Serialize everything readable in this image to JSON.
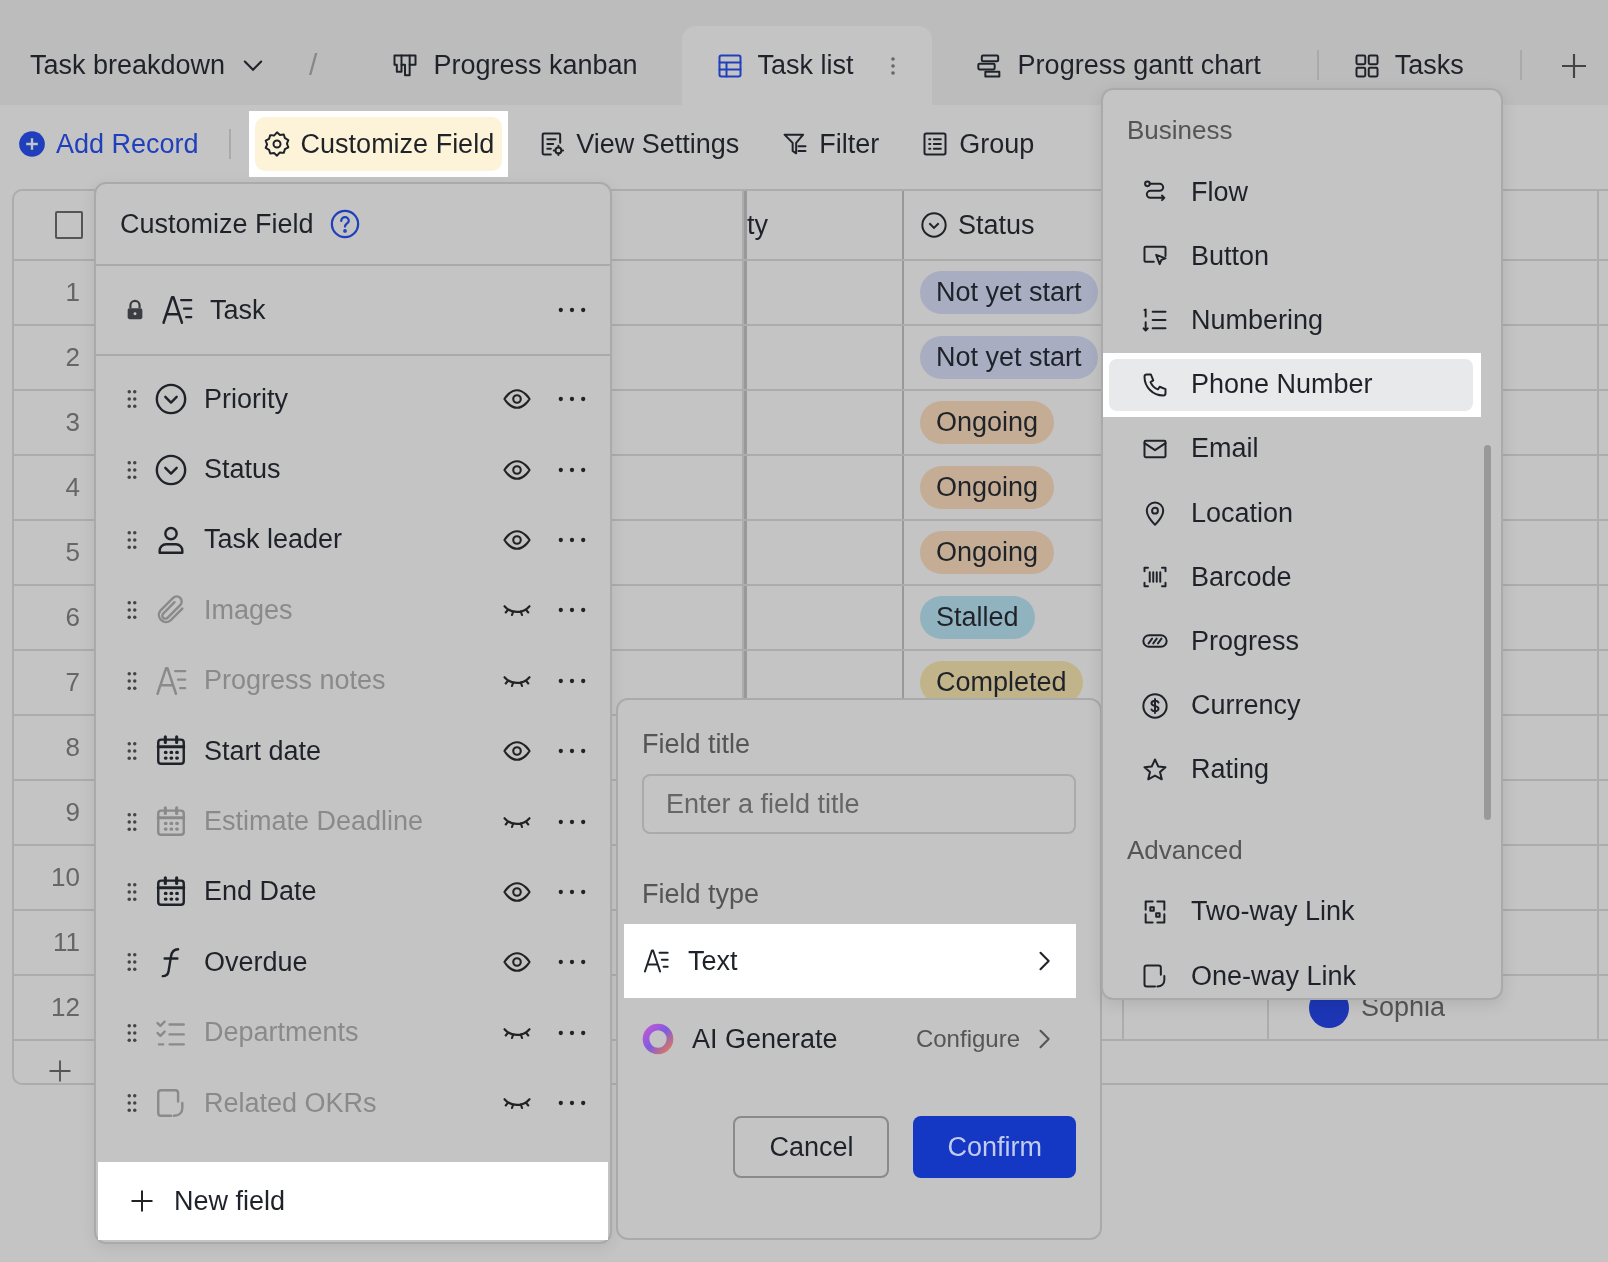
{
  "topbar": {
    "table_name": "Task breakdown",
    "separator": "/",
    "views": [
      {
        "label": "Progress kanban",
        "kind": "kanban",
        "selected": false
      },
      {
        "label": "Task list",
        "kind": "grid",
        "selected": true
      },
      {
        "label": "Progress gantt chart",
        "kind": "gantt",
        "selected": false
      },
      {
        "label": "Tasks",
        "kind": "gallery",
        "selected": false
      }
    ]
  },
  "toolbar": {
    "add_record": "Add Record",
    "items": [
      {
        "label": "Customize Field",
        "kind": "gear",
        "highlighted": true
      },
      {
        "label": "View Settings",
        "kind": "settings",
        "highlighted": false
      },
      {
        "label": "Filter",
        "kind": "filter",
        "highlighted": false
      },
      {
        "label": "Group",
        "kind": "group",
        "highlighted": false
      }
    ]
  },
  "table": {
    "select_all": {
      "checked": false
    },
    "columns": [
      "ty",
      "Status"
    ],
    "rows": [
      {
        "number": "1",
        "status": "Not yet start",
        "color": "#a8adc2"
      },
      {
        "number": "2",
        "status": "Not yet start",
        "color": "#a8adc2"
      },
      {
        "number": "3",
        "status": "Ongoing",
        "color": "#c4ad94"
      },
      {
        "number": "4",
        "status": "Ongoing",
        "color": "#c4ad94"
      },
      {
        "number": "5",
        "status": "Ongoing",
        "color": "#c4ad94"
      },
      {
        "number": "6",
        "status": "Stalled",
        "color": "#91b3bf"
      },
      {
        "number": "7",
        "status": "Completed",
        "color": "#c2b48a"
      },
      {
        "number": "8"
      },
      {
        "number": "9"
      },
      {
        "number": "10"
      },
      {
        "number": "11"
      },
      {
        "number": "12",
        "person": "Sophia"
      }
    ]
  },
  "customize_panel": {
    "title": "Customize Field",
    "primary": {
      "name": "Task",
      "kind": "text",
      "locked": true
    },
    "fields": [
      {
        "name": "Priority",
        "kind": "select",
        "hidden": false
      },
      {
        "name": "Status",
        "kind": "select",
        "hidden": false
      },
      {
        "name": "Task leader",
        "kind": "person",
        "hidden": false
      },
      {
        "name": "Images",
        "kind": "attachment",
        "hidden": true
      },
      {
        "name": "Progress notes",
        "kind": "text",
        "hidden": true
      },
      {
        "name": "Start date",
        "kind": "date",
        "hidden": false
      },
      {
        "name": "Estimate Deadline",
        "kind": "date",
        "hidden": true
      },
      {
        "name": "End Date",
        "kind": "date",
        "hidden": false
      },
      {
        "name": "Overdue",
        "kind": "formula",
        "hidden": false
      },
      {
        "name": "Departments",
        "kind": "checklist",
        "hidden": true
      },
      {
        "name": "Related OKRs",
        "kind": "onewaylink",
        "hidden": true
      }
    ],
    "new_field": {
      "label": "New field",
      "highlighted": true
    }
  },
  "field_dialog": {
    "title_label": "Field title",
    "title_placeholder": "Enter a field title",
    "type_label": "Field type",
    "type": {
      "label": "Text",
      "kind": "text",
      "highlighted": true
    },
    "ai": {
      "label": "AI Generate",
      "action": "Configure"
    },
    "buttons": [
      {
        "label": "Cancel",
        "kind": "secondary"
      },
      {
        "label": "Confirm",
        "kind": "primary"
      }
    ]
  },
  "type_menu": {
    "groups": [
      {
        "heading": "Business",
        "items": [
          {
            "label": "Flow",
            "kind": "flow",
            "highlighted": false
          },
          {
            "label": "Button",
            "kind": "button",
            "highlighted": false
          },
          {
            "label": "Numbering",
            "kind": "numbering",
            "highlighted": false
          },
          {
            "label": "Phone Number",
            "kind": "phone",
            "highlighted": true
          },
          {
            "label": "Email",
            "kind": "email",
            "highlighted": false
          },
          {
            "label": "Location",
            "kind": "location",
            "highlighted": false
          },
          {
            "label": "Barcode",
            "kind": "barcode",
            "highlighted": false
          },
          {
            "label": "Progress",
            "kind": "progress",
            "highlighted": false
          },
          {
            "label": "Currency",
            "kind": "currency",
            "highlighted": false
          },
          {
            "label": "Rating",
            "kind": "rating",
            "highlighted": false
          }
        ]
      },
      {
        "heading": "Advanced",
        "items": [
          {
            "label": "Two-way Link",
            "kind": "twowaylink",
            "highlighted": false
          },
          {
            "label": "One-way Link",
            "kind": "onewaylink",
            "highlighted": false
          }
        ]
      }
    ]
  }
}
